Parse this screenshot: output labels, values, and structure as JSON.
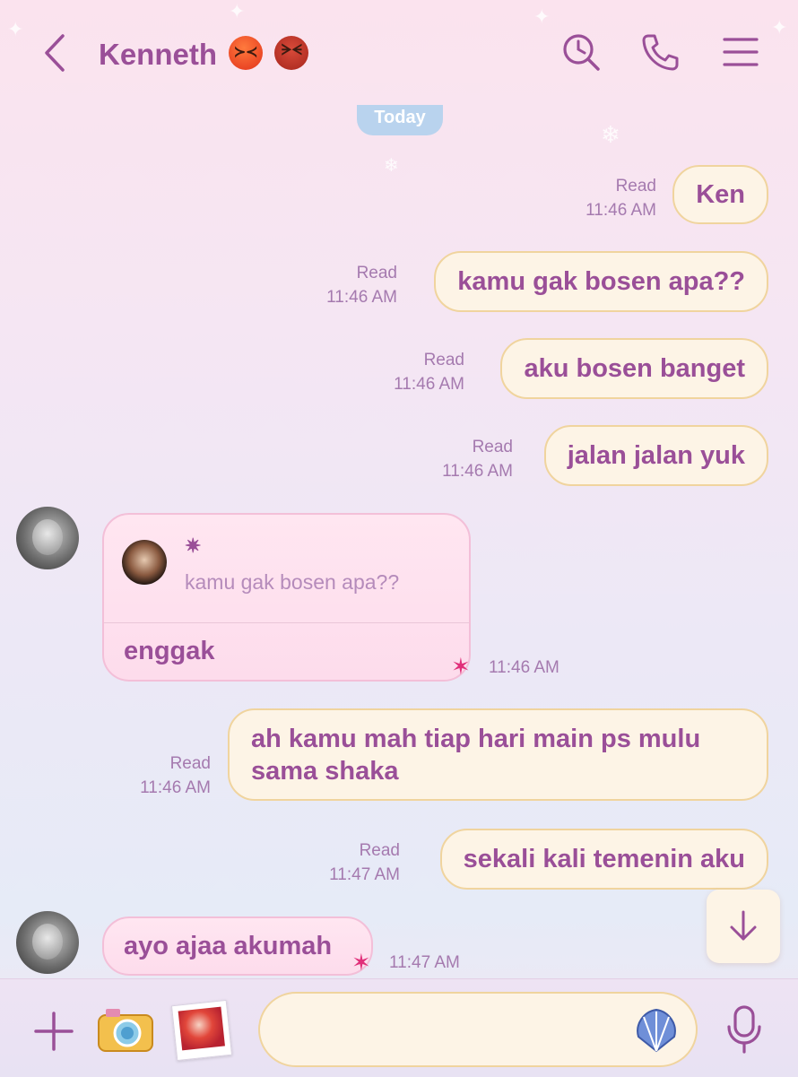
{
  "header": {
    "title": "Kenneth",
    "icons": [
      "back-chevron-icon",
      "search-clock-icon",
      "phone-icon",
      "menu-icon"
    ],
    "emoji": [
      "angry-face-emoji",
      "ogre-emoji"
    ]
  },
  "date_separator": "Today",
  "messages": [
    {
      "dir": "out",
      "text": "Ken",
      "status": "Read",
      "time": "11:46 AM"
    },
    {
      "dir": "out",
      "text": "kamu gak bosen apa??",
      "status": "Read",
      "time": "11:46 AM"
    },
    {
      "dir": "out",
      "text": "aku bosen banget",
      "status": "Read",
      "time": "11:46 AM"
    },
    {
      "dir": "out",
      "text": "jalan jalan yuk",
      "status": "Read",
      "time": "11:46 AM"
    },
    {
      "dir": "in",
      "reply": {
        "name": "✷",
        "quoted": "kamu gak bosen apa??"
      },
      "text": "enggak",
      "time": "11:46 AM"
    },
    {
      "dir": "out",
      "text": "ah kamu mah tiap hari main ps mulu sama shaka",
      "status": "Read",
      "time": "11:46 AM"
    },
    {
      "dir": "out",
      "text": "sekali kali temenin aku",
      "status": "Read",
      "time": "11:47 AM"
    },
    {
      "dir": "in",
      "text": "ayo ajaa akumah",
      "time": "11:47 AM"
    }
  ],
  "footer": {
    "input_value": "",
    "icons": [
      "plus-icon",
      "camera-icon",
      "gallery-icon",
      "shell-emoji-icon",
      "microphone-icon"
    ]
  },
  "colors": {
    "accent": "#9a4f98",
    "bubble_out": "#fdf4e6",
    "bubble_out_border": "#f0d49e",
    "bubble_in": "#fde1ef",
    "meta_text": "#a57aaf",
    "today_badge": "#b9d3ee"
  }
}
